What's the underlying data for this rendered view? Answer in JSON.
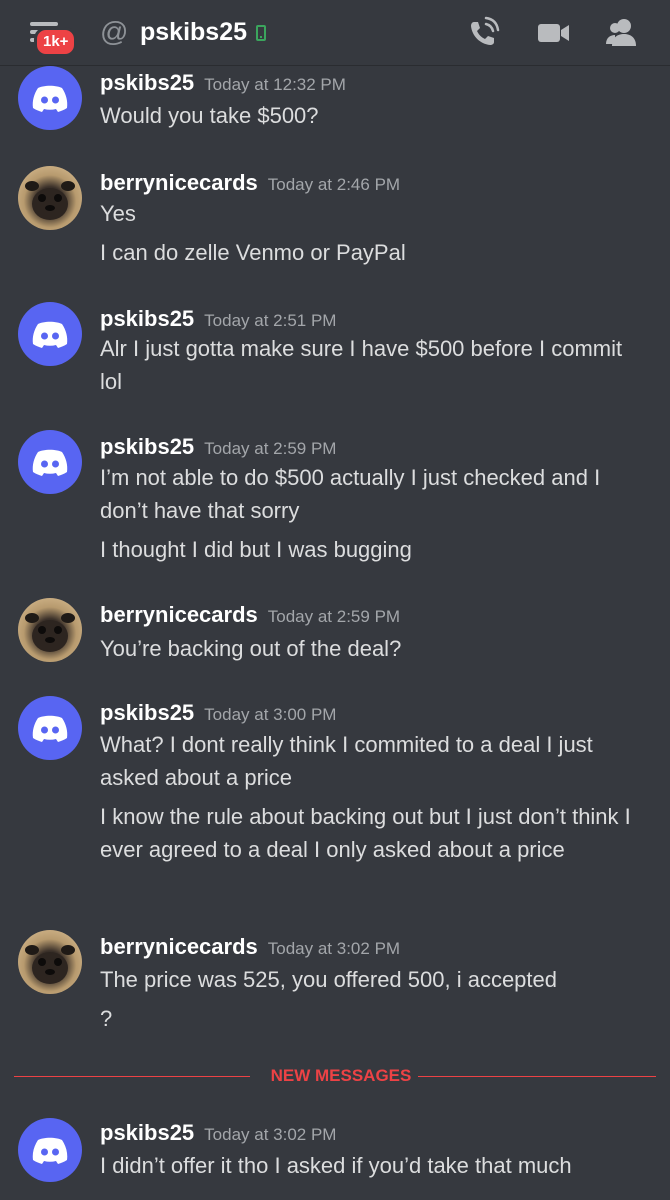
{
  "header": {
    "badge": "1k+",
    "at_symbol": "@",
    "channel_name": "pskibs25",
    "icons": [
      "menu-icon",
      "mobile-status-icon",
      "call-icon",
      "video-icon",
      "members-icon"
    ],
    "status_color": "#3ba55d"
  },
  "messages": [
    {
      "author": "pskibs25",
      "time": "Today at 12:32 PM",
      "avatar": "discord-logo-icon",
      "lines": [
        "Would you take $500?"
      ]
    },
    {
      "author": "berrynicecards",
      "time": "Today at 2:46 PM",
      "avatar": "pug-avatar",
      "lines": [
        "Yes",
        "I can do zelle Venmo or PayPal"
      ]
    },
    {
      "author": "pskibs25",
      "time": "Today at 2:51 PM",
      "avatar": "discord-logo-icon",
      "lines": [
        "Alr I just gotta make sure I have $500 before I commit lol"
      ]
    },
    {
      "author": "pskibs25",
      "time": "Today at 2:59 PM",
      "avatar": "discord-logo-icon",
      "lines": [
        "I’m not able to do $500 actually I just checked and I don’t have that sorry",
        "I thought I did but I was bugging"
      ]
    },
    {
      "author": "berrynicecards",
      "time": "Today at 2:59 PM",
      "avatar": "pug-avatar",
      "lines": [
        "You’re backing out of the deal?"
      ]
    },
    {
      "author": "pskibs25",
      "time": "Today at 3:00 PM",
      "avatar": "discord-logo-icon",
      "lines": [
        "What? I dont really think I commited to a deal I just asked about a price",
        "I know the rule about backing out but I just don’t think I ever agreed to a deal I only asked about a price"
      ]
    },
    {
      "author": "berrynicecards",
      "time": "Today at 3:02 PM",
      "avatar": "pug-avatar",
      "lines": [
        "The price was 525, you offered 500, i accepted",
        "?"
      ]
    },
    {
      "author": "pskibs25",
      "time": "Today at 3:02 PM",
      "avatar": "discord-logo-icon",
      "lines": [
        "I didn’t offer it tho I asked if you’d take that much"
      ]
    }
  ],
  "divider": {
    "label": "NEW MESSAGES",
    "color": "#ed4245"
  },
  "colors": {
    "background": "#36393f",
    "discord_blurple": "#5865f2",
    "badge_red": "#ed4245"
  }
}
